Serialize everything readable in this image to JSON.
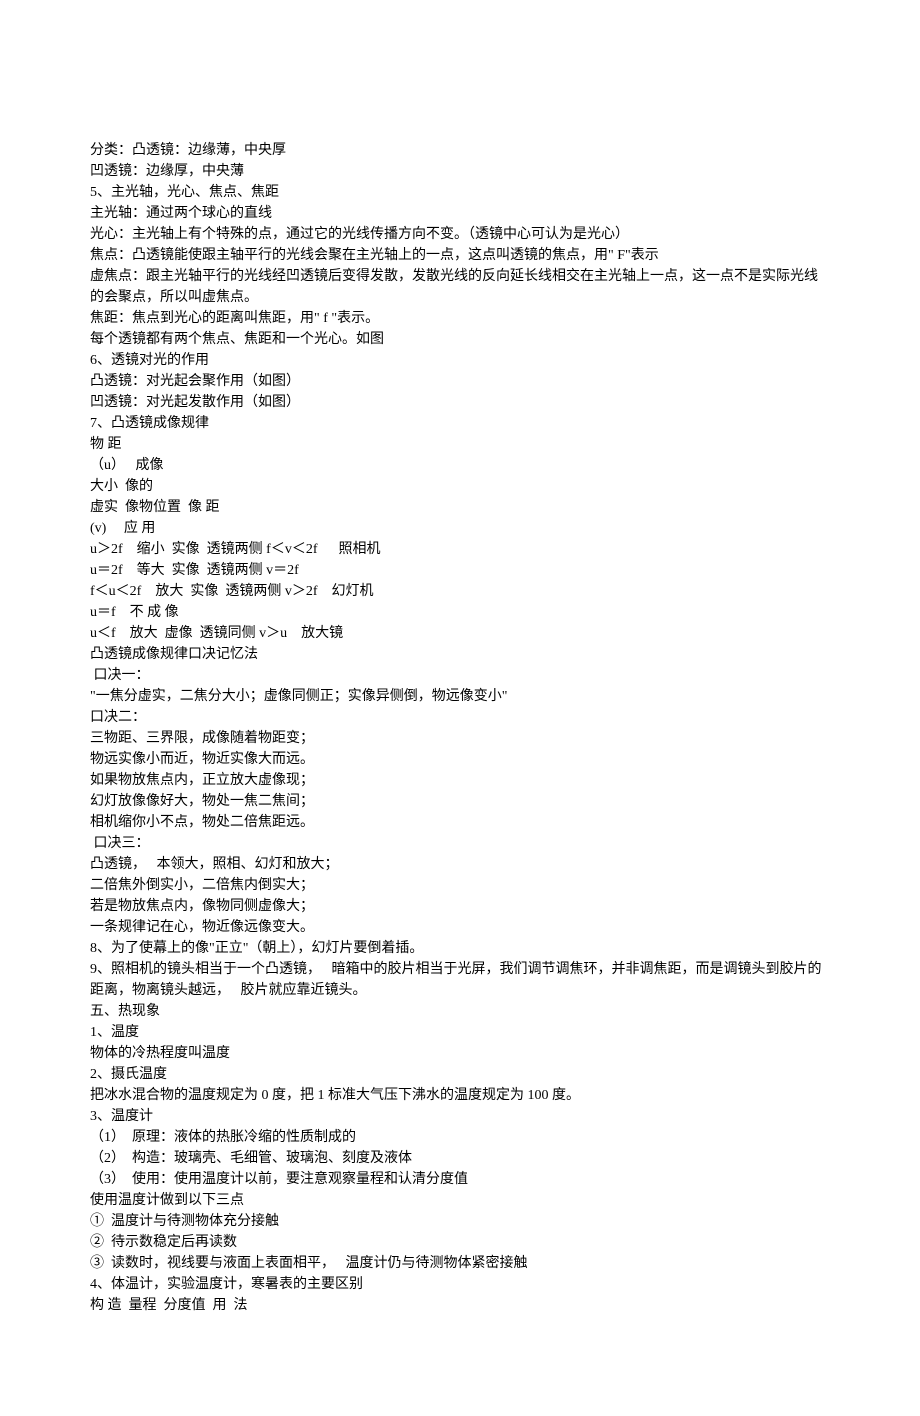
{
  "lines": [
    "分类：凸透镜：边缘薄，中央厚",
    "凹透镜：边缘厚，中央薄",
    "5、主光轴，光心、焦点、焦距",
    "主光轴：通过两个球心的直线",
    "光心：主光轴上有个特殊的点，通过它的光线传播方向不变。（透镜中心可认为是光心）",
    "焦点：凸透镜能使跟主轴平行的光线会聚在主光轴上的一点，这点叫透镜的焦点，用\" F\"表示",
    "虚焦点：跟主光轴平行的光线经凹透镜后变得发散，发散光线的反向延长线相交在主光轴上一点，这一点不是实际光线的会聚点，所以叫虚焦点。",
    "焦距：焦点到光心的距离叫焦距，用\" f \"表示。",
    "每个透镜都有两个焦点、焦距和一个光心。如图",
    "6、透镜对光的作用",
    "凸透镜：对光起会聚作用（如图）",
    "凹透镜：对光起发散作用（如图）",
    "7、凸透镜成像规律",
    "物 距",
    "（u）   成像",
    "大小  像的",
    "虚实  像物位置  像 距",
    "(v)     应 用",
    "u＞2f    缩小  实像  透镜两侧 f＜v＜2f      照相机",
    "u＝2f    等大  实像  透镜两侧 v＝2f",
    "f＜u＜2f    放大  实像  透镜两侧 v＞2f    幻灯机",
    "u＝f    不 成 像",
    "u＜f    放大  虚像  透镜同侧 v＞u    放大镜",
    "凸透镜成像规律口决记忆法",
    " 口决一：",
    "\"一焦分虚实，二焦分大小；虚像同侧正；实像异侧倒，物远像变小\"",
    "口决二：",
    "三物距、三界限，成像随着物距变；",
    "物远实像小而近，物近实像大而远。",
    "如果物放焦点内，正立放大虚像现；",
    "幻灯放像像好大，物处一焦二焦间；",
    "相机缩你小不点，物处二倍焦距远。",
    " 口决三：",
    "凸透镜，   本领大，照相、幻灯和放大；",
    "二倍焦外倒实小，二倍焦内倒实大；",
    "若是物放焦点内，像物同侧虚像大；",
    "一条规律记在心，物近像远像变大。",
    "8、为了使幕上的像\"正立\"（朝上），幻灯片要倒着插。",
    "9、照相机的镜头相当于一个凸透镜，   暗箱中的胶片相当于光屏，我们调节调焦环，并非调焦距，而是调镜头到胶片的距离，物离镜头越远，   胶片就应靠近镜头。",
    "五、热现象",
    "1、温度",
    "物体的冷热程度叫温度",
    "2、摄氏温度",
    "把冰水混合物的温度规定为 0 度，把 1 标准大气压下沸水的温度规定为 100 度。",
    "3、温度计",
    "（1）  原理：液体的热胀冷缩的性质制成的",
    "（2）  构造：玻璃壳、毛细管、玻璃泡、刻度及液体",
    "（3）  使用：使用温度计以前，要注意观察量程和认清分度值",
    "使用温度计做到以下三点",
    "①  温度计与待测物体充分接触",
    "②  待示数稳定后再读数",
    "③  读数时，视线要与液面上表面相平，   温度计仍与待测物体紧密接触",
    "4、体温计，实验温度计，寒暑表的主要区别",
    "构 造  量程  分度值  用  法"
  ]
}
